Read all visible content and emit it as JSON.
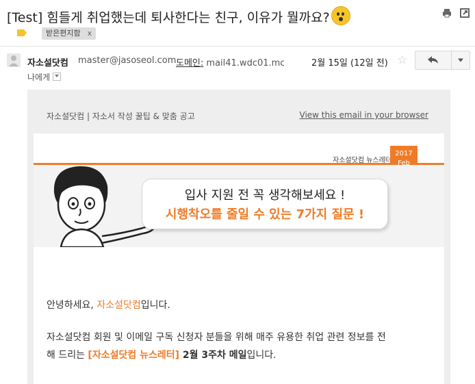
{
  "subject": {
    "tag": "[Test]",
    "text": "힘들게 취업했는데 퇴사한다는 친구, 이유가 뭘까요?",
    "emoji": "hushed-face-emoji"
  },
  "labels": {
    "inbox_chip": "받은편지함",
    "remove": "x"
  },
  "sender": {
    "name": "자소설닷컴",
    "email": "master@jasoseol.com",
    "domain_label": "도메인:",
    "domain": "mail41.wdc01.mc",
    "date": "2월 15일 (12일 전)",
    "to": "나에게"
  },
  "icons": {
    "print": "print-icon",
    "new_window": "new-window-icon",
    "star": "star-icon",
    "reply": "reply-icon",
    "more": "chevron-down-icon"
  },
  "email": {
    "preheader": "자소설닷컴 | 자소서 작성 꿀팁 & 맞춤 공고",
    "view_link": "View this email in your browser",
    "newsletter_label": "자소설닷컴 뉴스레터",
    "ribbon_year": "2017",
    "ribbon_month": "Feb",
    "bubble_line1": "입사 지원 전 꼭 생각해보세요 !",
    "bubble_line2": "시행착오를 줄일 수 있는 7가지 질문 !",
    "greeting_prefix": "안녕하세요, ",
    "greeting_brand": "자소설닷컴",
    "greeting_suffix": "입니다.",
    "para_line1": "자소설닷컴 회원 및 이메일 구독 신청자 분들을 위해 매주 유용한 취업 관련 정보를 전",
    "para_prefix": "해 드리는 ",
    "para_brand": "[자소설닷컴 뉴스레터]",
    "para_week": " 2월 3주차 메일",
    "para_suffix": "입니다."
  },
  "colors": {
    "accent": "#f07b27",
    "label_chip": "#dddddd",
    "body_bg": "#eeeeee"
  }
}
